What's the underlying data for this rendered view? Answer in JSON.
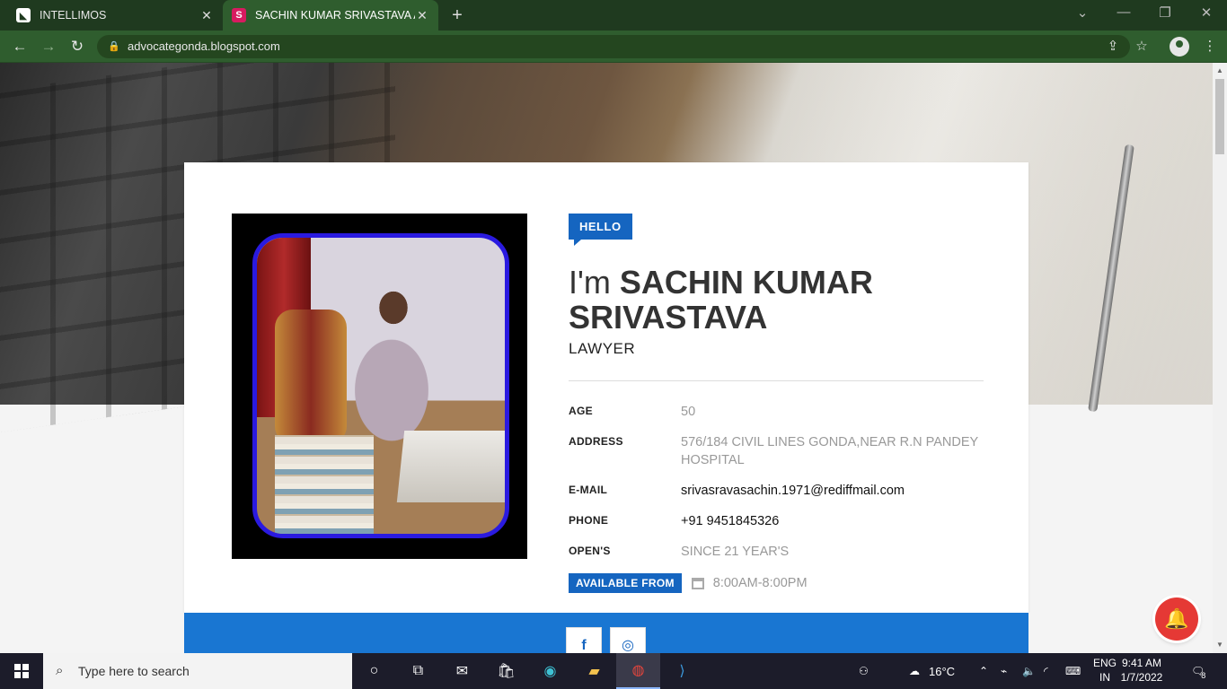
{
  "browser": {
    "tabs": [
      {
        "title": "INTELLIMOS",
        "favicon": "intellimos-icon"
      },
      {
        "title": "SACHIN KUMAR SRIVASTAVA ADV",
        "favicon": "blog-s-icon"
      }
    ],
    "url": "advocategonda.blogspot.com"
  },
  "profile": {
    "hello_label": "HELLO",
    "intro": "I'm",
    "name_line1": "SACHIN KUMAR",
    "name_line2": "SRIVASTAVA",
    "role": "LAWYER",
    "fields": [
      {
        "label": "AGE",
        "value": "50"
      },
      {
        "label": "ADDRESS",
        "value": "576/184 CIVIL LINES GONDA,NEAR R.N PANDEY HOSPITAL"
      },
      {
        "label": "E-MAIL",
        "value": "srivasravasachin.1971@rediffmail.com"
      },
      {
        "label": "PHONE",
        "value": "+91 9451845326"
      },
      {
        "label": "OPEN'S",
        "value": "SINCE 21 YEAR'S"
      }
    ],
    "availability": {
      "label": "AVAILABLE FROM",
      "hours": "8:00AM-8:00PM"
    }
  },
  "social": {
    "facebook": "f",
    "instagram": "◎"
  },
  "taskbar": {
    "search_placeholder": "Type here to search",
    "weather": "16°C",
    "lang_line1": "ENG",
    "lang_line2": "IN",
    "time": "9:41 AM",
    "date": "1/7/2022",
    "notifications": "8"
  },
  "colors": {
    "accent": "#1565c0",
    "chrome_green": "#2f5d2e",
    "photo_border": "#2a1ae0",
    "bell": "#e53935"
  }
}
